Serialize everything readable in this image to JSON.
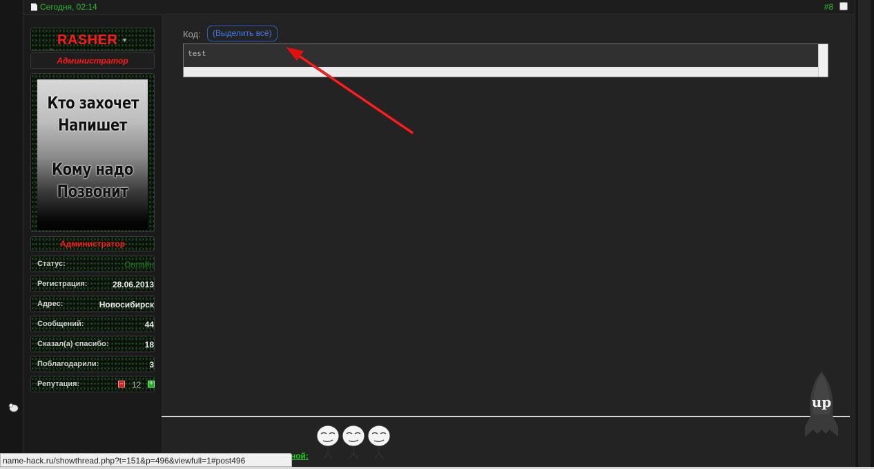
{
  "post": {
    "date": "Сегодня, 02:14",
    "number": "#8"
  },
  "user": {
    "name": "RASHER",
    "title": "Администратор",
    "rank": "Администратор",
    "avatar_text": [
      "Кто захочет",
      "Напишет",
      "Кому надо",
      "Позвонит"
    ],
    "stats": [
      {
        "label": "Статус:",
        "value": "Онлайн"
      },
      {
        "label": "Регистрация:",
        "value": "28.06.2013"
      },
      {
        "label": "Адрес:",
        "value": "Новосибирск"
      },
      {
        "label": "Сообщений:",
        "value": "44"
      },
      {
        "label": "Сказал(а) спасибо:",
        "value": "18"
      },
      {
        "label": "Поблагодарили:",
        "value": "3"
      }
    ],
    "reputation": {
      "label": "Репутация:",
      "value": "12",
      "minus": "–",
      "plus": "+"
    }
  },
  "code": {
    "label": "Код:",
    "select_all": "(Выделить всё)",
    "content": "test"
  },
  "signature": {
    "text": "мной:"
  },
  "up_button": {
    "label": "up"
  },
  "status_bar": {
    "url": "name-hack.ru/showthread.php?t=151&p=496&viewfull=1#post496"
  },
  "colors": {
    "accent_green": "#29b829",
    "name_red": "#ff1a1a",
    "link_blue": "#3d7ce8",
    "annotation_arrow": "#e01010"
  },
  "icons": [
    "document-icon",
    "checkbox-icon",
    "dropdown-caret-icon",
    "chicken-icon",
    "reputation-minus-icon",
    "reputation-plus-icon",
    "rocket-up-icon",
    "meme-faces"
  ]
}
